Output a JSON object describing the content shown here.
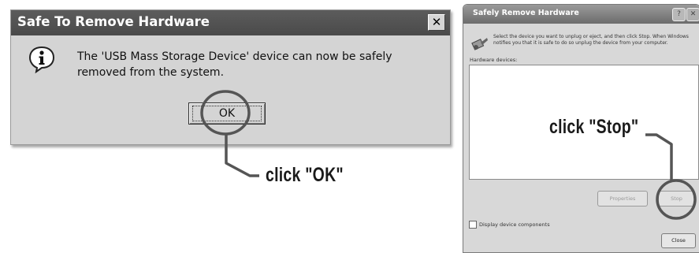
{
  "left_dialog": {
    "title": "Safe To Remove Hardware",
    "close_glyph": "✕",
    "message": "The 'USB Mass Storage Device' device can now be safely removed from the system.",
    "ok_label": "OK",
    "icon": "info-icon"
  },
  "right_dialog": {
    "title": "Safely Remove Hardware",
    "help_glyph": "?",
    "close_glyph": "✕",
    "instructions": "Select the device you want to unplug or eject, and then click Stop. When Windows notifies you that it is safe to do so unplug the device from your computer.",
    "hardware_label": "Hardware devices:",
    "properties_label": "Properties",
    "stop_label": "Stop",
    "checkbox_label": "Display device components",
    "close_label": "Close",
    "icon": "hardware-icon"
  },
  "annotations": {
    "ok_callout": "click \"OK\"",
    "stop_callout": "click \"Stop\""
  }
}
